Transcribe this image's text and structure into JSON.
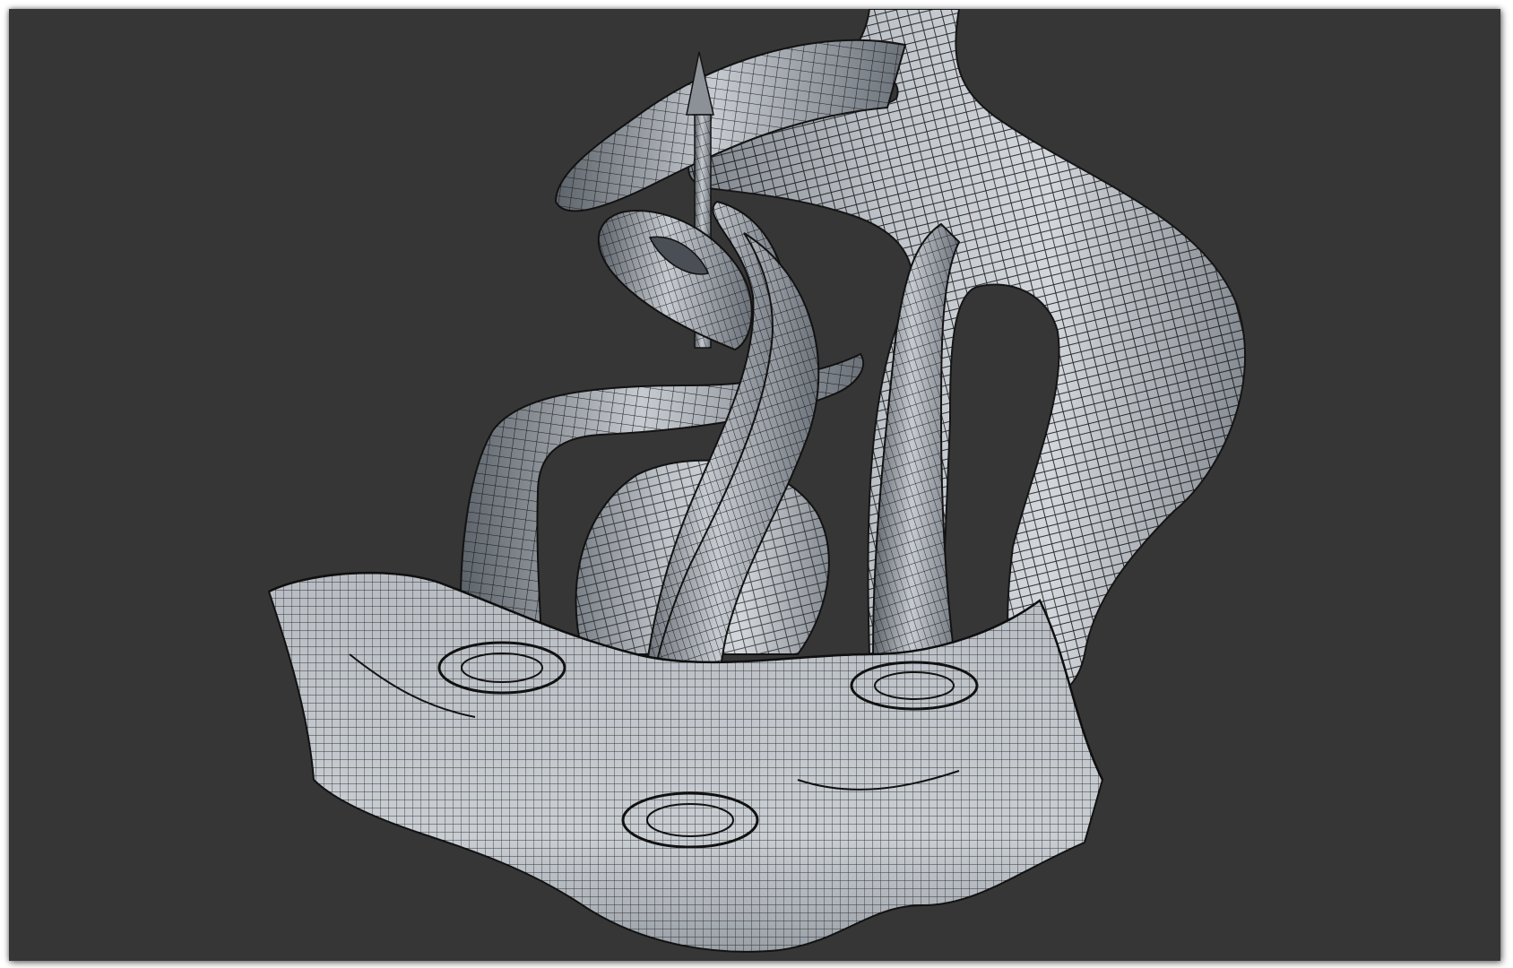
{
  "viewport": {
    "background_color": "#363636",
    "mesh_fill_light": "#c4c9cf",
    "mesh_fill_dark": "#6e747b",
    "wire_color": "#1a1a1a",
    "model_icon": "wireframe-sculpture-icon"
  }
}
